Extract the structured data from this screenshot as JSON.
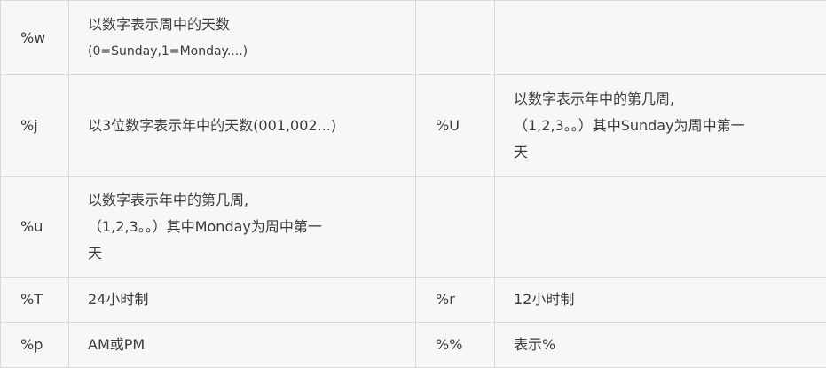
{
  "rows": [
    {
      "left_code": "%w",
      "left_desc": "以数字表示周中的天数",
      "left_desc_sub": "(0=Sunday,1=Monday....)",
      "right_code": "",
      "right_desc": ""
    },
    {
      "left_code": "%j",
      "left_desc": "以3位数字表示年中的天数(001,002...)",
      "right_code": "%U",
      "right_desc_lines": [
        "以数字表示年中的第几周,",
        "（1,2,3。。）其中Sunday为周中第一",
        "天"
      ]
    },
    {
      "left_code": "%u",
      "left_desc_lines": [
        "以数字表示年中的第几周,",
        "（1,2,3。。）其中Monday为周中第一",
        "天"
      ],
      "right_code": "",
      "right_desc": ""
    },
    {
      "left_code": "%T",
      "left_desc": "24小时制",
      "right_code": "%r",
      "right_desc": "12小时制"
    },
    {
      "left_code": "%p",
      "left_desc": "AM或PM",
      "right_code": "%%",
      "right_desc": "表示%"
    }
  ]
}
